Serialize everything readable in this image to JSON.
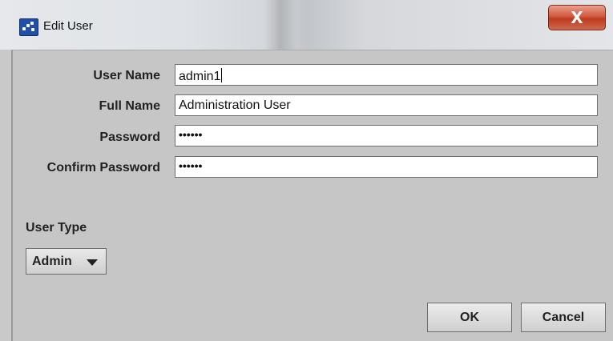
{
  "window": {
    "title": "Edit User",
    "close_glyph": "X"
  },
  "form": {
    "user_name": {
      "label": "User Name",
      "value": "admin1"
    },
    "full_name": {
      "label": "Full Name",
      "value": "Administration User"
    },
    "password": {
      "label": "Password",
      "value": "••••••"
    },
    "confirm_password": {
      "label": "Confirm Password",
      "value": "••••••"
    }
  },
  "user_type": {
    "label": "User Type",
    "selected": "Admin"
  },
  "buttons": {
    "ok": "OK",
    "cancel": "Cancel"
  },
  "colors": {
    "close_button": "#c9452a",
    "app_icon": "#1f4fa8"
  },
  "icons": {
    "app": "app-icon",
    "close": "close-icon",
    "dropdown": "chevron-down-icon"
  }
}
